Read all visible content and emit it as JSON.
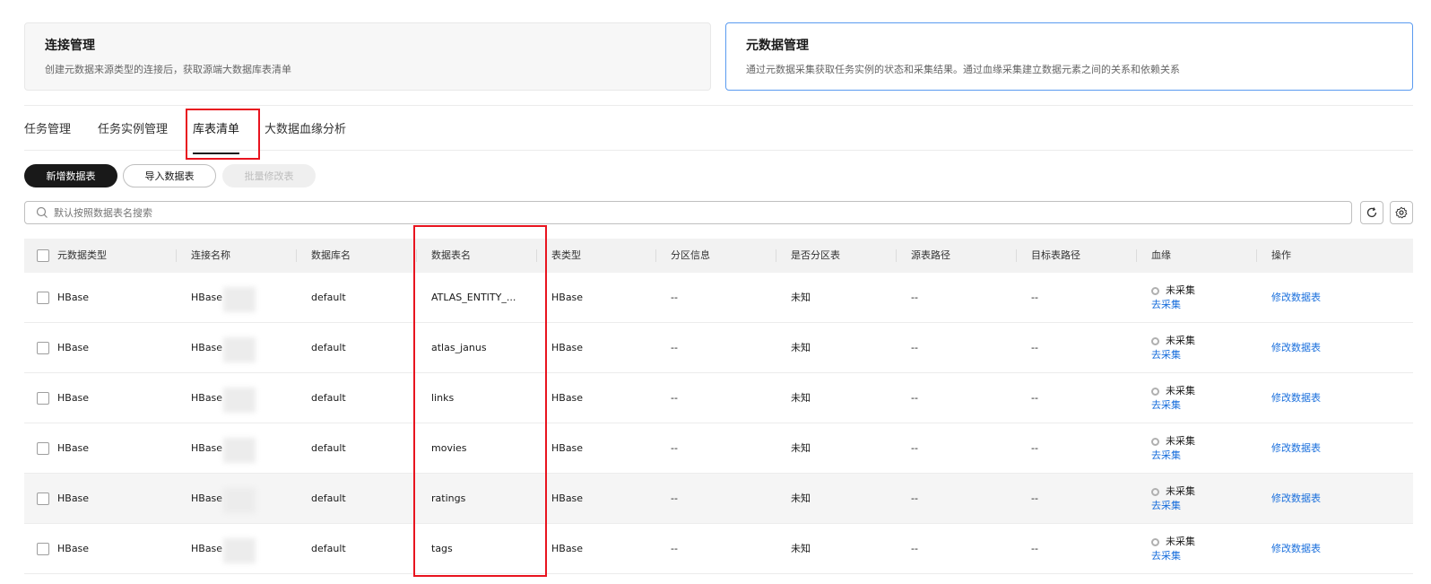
{
  "cards": [
    {
      "title": "连接管理",
      "desc": "创建元数据来源类型的连接后，获取源端大数据库表清单"
    },
    {
      "title": "元数据管理",
      "desc": "通过元数据采集获取任务实例的状态和采集结果。通过血缘采集建立数据元素之间的关系和依赖关系"
    }
  ],
  "tabs": [
    "任务管理",
    "任务实例管理",
    "库表清单",
    "大数据血缘分析"
  ],
  "active_tab": "库表清单",
  "toolbar": {
    "add_label": "新增数据表",
    "import_label": "导入数据表",
    "batch_label": "批量修改表"
  },
  "search": {
    "placeholder": "默认按照数据表名搜索"
  },
  "table": {
    "headers": [
      "元数据类型",
      "连接名称",
      "数据库名",
      "数据表名",
      "表类型",
      "分区信息",
      "是否分区表",
      "源表路径",
      "目标表路径",
      "血缘",
      "操作"
    ],
    "rows": [
      {
        "type": "HBase",
        "conn": "HBase",
        "db": "default",
        "name": "ATLAS_ENTITY_...",
        "table_type": "HBase",
        "partition": "--",
        "is_partition": "未知",
        "src_path": "--",
        "dst_path": "--",
        "lineage_status": "未采集",
        "lineage_action": "去采集",
        "action": "修改数据表"
      },
      {
        "type": "HBase",
        "conn": "HBase",
        "db": "default",
        "name": "atlas_janus",
        "table_type": "HBase",
        "partition": "--",
        "is_partition": "未知",
        "src_path": "--",
        "dst_path": "--",
        "lineage_status": "未采集",
        "lineage_action": "去采集",
        "action": "修改数据表"
      },
      {
        "type": "HBase",
        "conn": "HBase",
        "db": "default",
        "name": "links",
        "table_type": "HBase",
        "partition": "--",
        "is_partition": "未知",
        "src_path": "--",
        "dst_path": "--",
        "lineage_status": "未采集",
        "lineage_action": "去采集",
        "action": "修改数据表"
      },
      {
        "type": "HBase",
        "conn": "HBase",
        "db": "default",
        "name": "movies",
        "table_type": "HBase",
        "partition": "--",
        "is_partition": "未知",
        "src_path": "--",
        "dst_path": "--",
        "lineage_status": "未采集",
        "lineage_action": "去采集",
        "action": "修改数据表"
      },
      {
        "type": "HBase",
        "conn": "HBase",
        "db": "default",
        "name": "ratings",
        "table_type": "HBase",
        "partition": "--",
        "is_partition": "未知",
        "src_path": "--",
        "dst_path": "--",
        "lineage_status": "未采集",
        "lineage_action": "去采集",
        "action": "修改数据表"
      },
      {
        "type": "HBase",
        "conn": "HBase",
        "db": "default",
        "name": "tags",
        "table_type": "HBase",
        "partition": "--",
        "is_partition": "未知",
        "src_path": "--",
        "dst_path": "--",
        "lineage_status": "未采集",
        "lineage_action": "去采集",
        "action": "修改数据表"
      }
    ]
  },
  "colors": {
    "accent": "#191919",
    "link": "#1a6fdc",
    "highlight": "#e8141f",
    "selected_card_border": "#5a9bf0"
  },
  "icons": {
    "search": "search-icon",
    "refresh": "refresh-icon",
    "settings": "gear-icon",
    "status": "status-dot-icon"
  }
}
